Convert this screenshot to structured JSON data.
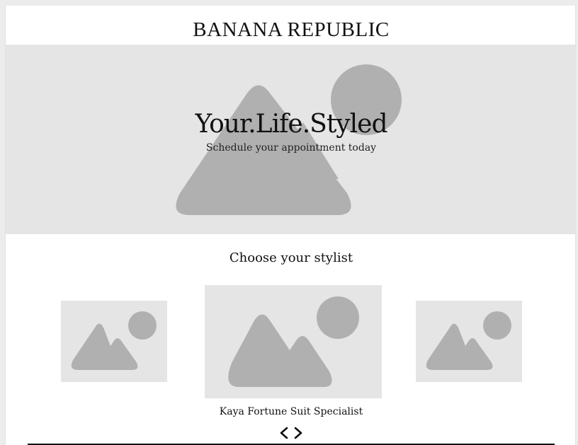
{
  "header": {
    "brand": "BANANA REPUBLIC"
  },
  "hero": {
    "title": "Your.Life.Styled",
    "subtitle": "Schedule your appointment today"
  },
  "stylists": {
    "heading": "Choose your stylist",
    "selected_caption": "Kaya Fortune Suit Specialist",
    "cards": [
      {
        "icon": "image-placeholder-icon"
      },
      {
        "icon": "image-placeholder-icon"
      },
      {
        "icon": "image-placeholder-icon"
      }
    ],
    "nav": {
      "prev_icon": "chevron-left-icon",
      "next_icon": "chevron-right-icon"
    }
  },
  "colors": {
    "placeholder_bg": "#e5e5e5",
    "placeholder_shape": "#b0b0b0",
    "text": "#111111"
  }
}
